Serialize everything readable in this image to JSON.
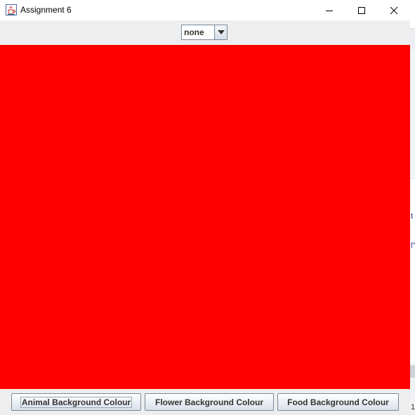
{
  "window": {
    "title": "Assignment 6",
    "icon": "java-cup-icon",
    "controls": [
      "minimize-icon",
      "maximize-icon",
      "close-icon"
    ]
  },
  "combo": {
    "selected": "none"
  },
  "canvas": {
    "background_color": "#ff0000"
  },
  "buttons": {
    "animal": "Animal Background Colour",
    "flower": "Flower Background Colour",
    "food": "Food Background Colour"
  },
  "background_app": {
    "fragments": [
      "t",
      "l\"",
      "1"
    ]
  }
}
